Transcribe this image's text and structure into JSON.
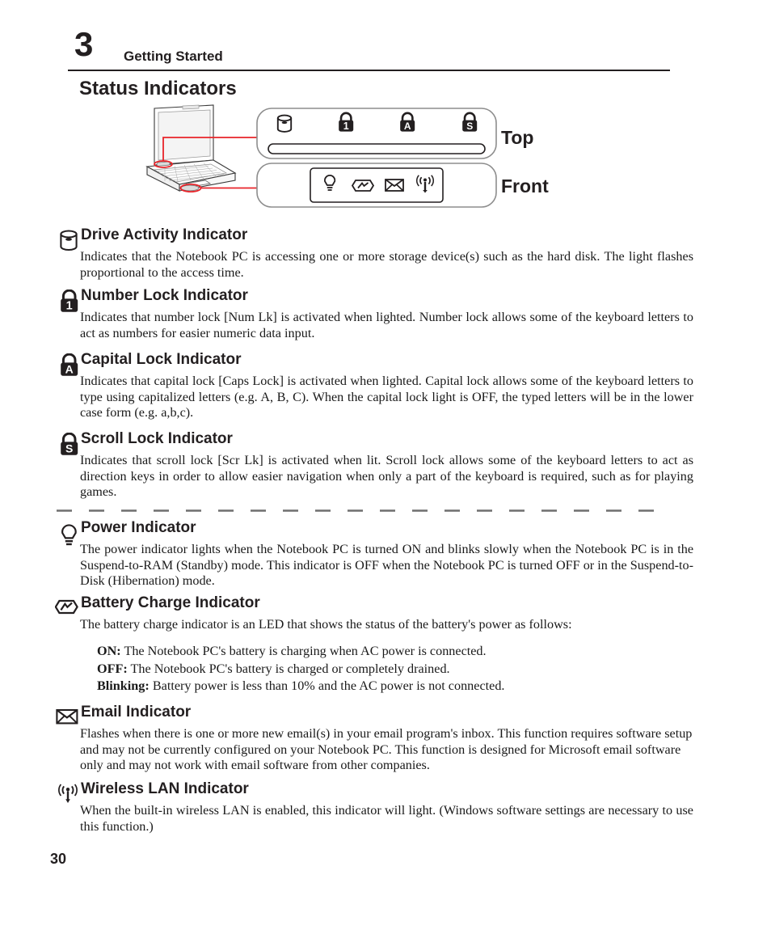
{
  "header": {
    "chapter_number": "3",
    "chapter_title": "Getting Started",
    "page_title": "Status Indicators"
  },
  "diagram": {
    "label_top": "Top",
    "label_front": "Front",
    "top_panel_icons": [
      "drive-activity-icon",
      "number-lock-icon",
      "capital-lock-icon",
      "scroll-lock-icon"
    ],
    "front_panel_icons": [
      "power-icon",
      "battery-icon",
      "email-icon",
      "wireless-lan-icon"
    ],
    "callout_color": "#e8242a"
  },
  "footer": {
    "page_number": "30"
  },
  "sections": [
    {
      "icon": "drive-activity-icon",
      "title": "Drive Activity Indicator",
      "body": "Indicates that the Notebook PC is accessing one or more storage device(s) such as the hard disk. The light flashes proportional to the access time."
    },
    {
      "icon": "number-lock-icon",
      "title": "Number Lock Indicator",
      "body": "Indicates that number lock [Num Lk] is activated when lighted. Number lock allows some of the  keyboard letters to act as numbers for easier numeric data input."
    },
    {
      "icon": "capital-lock-icon",
      "title": "Capital Lock Indicator",
      "body": "Indicates that capital lock [Caps Lock] is activated when lighted. Capital lock allows some of the keyboard letters to type using capitalized letters (e.g. A, B, C). When the capital lock light is OFF, the typed letters will be in the lower case form (e.g. a,b,c)."
    },
    {
      "icon": "scroll-lock-icon",
      "title": "Scroll Lock Indicator",
      "body": "Indicates that scroll lock [Scr Lk] is activated when lit. Scroll lock allows some of the keyboard letters to act as direction keys in order to allow easier navigation when only a part of the keyboard is required, such as for playing games."
    },
    {
      "icon": "power-icon",
      "title": "Power Indicator",
      "body": "The power indicator lights when the Notebook PC is turned ON and blinks slowly when the Notebook PC is in the Suspend-to-RAM (Standby) mode. This indicator is OFF when the Notebook PC is turned OFF or in the Suspend-to-Disk (Hibernation) mode."
    },
    {
      "icon": "battery-icon",
      "title": "Battery Charge Indicator",
      "body": "The battery charge indicator is an LED that shows the status of the battery's power as follows:",
      "states": [
        {
          "label": "ON:",
          "text": "The Notebook PC's battery is charging when AC power is connected."
        },
        {
          "label": "OFF:",
          "text": "The Notebook PC's battery is charged or completely drained."
        },
        {
          "label": "Blinking:",
          "text": "Battery power is less than 10% and the AC power is not connected."
        }
      ]
    },
    {
      "icon": "email-icon",
      "title": "Email Indicator",
      "body": "Flashes when there is one or more new email(s) in your email program's inbox. This function requires software setup and may not be currently configured on your Notebook PC. This function is designed for Microsoft email software only and may not work with email software from other companies."
    },
    {
      "icon": "wireless-lan-icon",
      "title": "Wireless LAN Indicator",
      "body": "When the built-in wireless LAN is enabled, this indicator will light. (Windows software settings are necessary to use this function.)"
    }
  ]
}
